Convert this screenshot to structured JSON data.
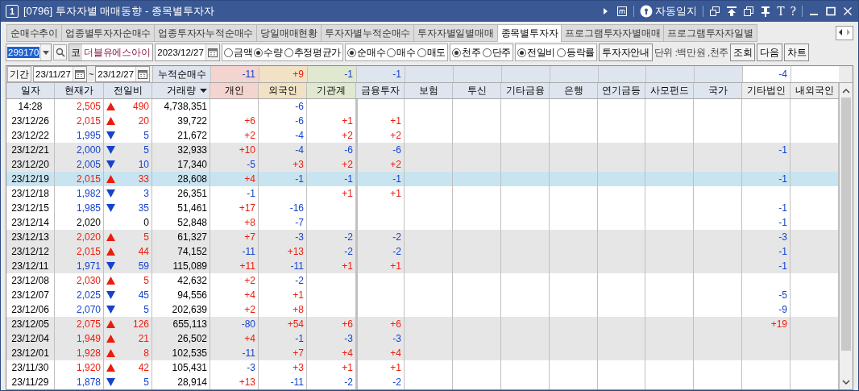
{
  "window": {
    "number": "1",
    "title": "[0796] 투자자별 매매동향 - 종목별투자자",
    "journal": "자동일지",
    "tool_letters": [
      "T",
      "?"
    ]
  },
  "tabs": [
    {
      "label": "순매수추이",
      "selected": false
    },
    {
      "label": "업종별투자자순매수",
      "selected": false
    },
    {
      "label": "업종투자자누적순매수",
      "selected": false
    },
    {
      "label": "당일매매현황",
      "selected": false
    },
    {
      "label": "투자자별누적순매수",
      "selected": false
    },
    {
      "label": "투자자별일별매매",
      "selected": false
    },
    {
      "label": "종목별투자자",
      "selected": true
    },
    {
      "label": "프로그램투자자별매매",
      "selected": false
    },
    {
      "label": "프로그램투자자일별",
      "selected": false
    }
  ],
  "toolbar": {
    "code": {
      "value": "299170",
      "highlighted": true
    },
    "market": "코",
    "stock_name": "더블유에스아이",
    "date": "2023/12/27",
    "radio_groups": [
      [
        {
          "label": "금액",
          "selected": false
        },
        {
          "label": "수량",
          "selected": true
        },
        {
          "label": "추정평균가",
          "selected": false
        }
      ],
      [
        {
          "label": "순매수",
          "selected": true
        },
        {
          "label": "매수",
          "selected": false
        },
        {
          "label": "매도",
          "selected": false
        }
      ],
      [
        {
          "label": "천주",
          "selected": true
        },
        {
          "label": "단주",
          "selected": false
        }
      ],
      [
        {
          "label": "전일비",
          "selected": true
        },
        {
          "label": "등락률",
          "selected": false
        }
      ]
    ],
    "guide_button": "투자자안내",
    "unit": "단위 :백만원 ,천주",
    "buttons": [
      "조회",
      "다음",
      "차트"
    ]
  },
  "period": {
    "label": "기간",
    "from": "23/11/27",
    "separator": "~",
    "to": "23/12/27"
  },
  "summary": {
    "label": "누적순매수",
    "values": {
      "individual": "-11",
      "foreign": "+9",
      "institutions": "-1",
      "financial_investment": "-1",
      "other_corporations": "-4"
    }
  },
  "table": {
    "columns": [
      {
        "label": "일자",
        "dropdown": false
      },
      {
        "label": "현재가",
        "dropdown": false
      },
      {
        "label": "전일비",
        "dropdown": false
      },
      {
        "label": "거래량",
        "dropdown": true
      },
      {
        "label": "개인",
        "dropdown": false
      },
      {
        "label": "외국인",
        "dropdown": false
      },
      {
        "label": "기관계",
        "dropdown": false
      },
      {
        "label": "금융투자",
        "dropdown": false
      },
      {
        "label": "보험",
        "dropdown": false
      },
      {
        "label": "투신",
        "dropdown": false
      },
      {
        "label": "기타금융",
        "dropdown": false
      },
      {
        "label": "은행",
        "dropdown": false
      },
      {
        "label": "연기금등",
        "dropdown": false
      },
      {
        "label": "사모펀드",
        "dropdown": false
      },
      {
        "label": "국가",
        "dropdown": false
      },
      {
        "label": "기타법인",
        "dropdown": false
      },
      {
        "label": "내외국인",
        "dropdown": false
      }
    ],
    "rows": [
      {
        "date": "14:28",
        "price": "2,505",
        "kind": "up",
        "change": "490",
        "volume": "4,738,351",
        "shaded": false,
        "selected": false,
        "investors": {
          "foreign": "-6"
        }
      },
      {
        "date": "23/12/26",
        "price": "2,015",
        "kind": "up",
        "change": "20",
        "volume": "39,722",
        "shaded": false,
        "selected": false,
        "investors": {
          "individual": "+6",
          "foreign": "-6",
          "institutions": "+1",
          "financial_investment": "+1"
        }
      },
      {
        "date": "23/12/22",
        "price": "1,995",
        "kind": "down",
        "change": "5",
        "volume": "21,672",
        "shaded": false,
        "selected": false,
        "investors": {
          "individual": "+2",
          "foreign": "-4",
          "institutions": "+2",
          "financial_investment": "+2"
        }
      },
      {
        "date": "23/12/21",
        "price": "2,000",
        "kind": "down",
        "change": "5",
        "volume": "32,933",
        "shaded": true,
        "selected": false,
        "investors": {
          "individual": "+10",
          "foreign": "-4",
          "institutions": "-6",
          "financial_investment": "-6",
          "other_corporations": "-1"
        }
      },
      {
        "date": "23/12/20",
        "price": "2,005",
        "kind": "down",
        "change": "10",
        "volume": "17,340",
        "shaded": true,
        "selected": false,
        "investors": {
          "individual": "-5",
          "foreign": "+3",
          "institutions": "+2",
          "financial_investment": "+2"
        }
      },
      {
        "date": "23/12/19",
        "price": "2,015",
        "kind": "up",
        "change": "33",
        "volume": "28,608",
        "selected": true,
        "investors": {
          "individual": "+4",
          "foreign": "-1",
          "institutions": "-1",
          "financial_investment": "-1",
          "other_corporations": "-1"
        }
      },
      {
        "date": "23/12/18",
        "price": "1,982",
        "kind": "down",
        "change": "3",
        "volume": "26,351",
        "shaded": false,
        "selected": false,
        "investors": {
          "individual": "-1",
          "institutions": "+1",
          "financial_investment": "+1"
        }
      },
      {
        "date": "23/12/15",
        "price": "1,985",
        "kind": "down",
        "change": "35",
        "volume": "51,461",
        "shaded": false,
        "selected": false,
        "investors": {
          "individual": "+17",
          "foreign": "-16",
          "other_corporations": "-1"
        }
      },
      {
        "date": "23/12/14",
        "price": "2,020",
        "kind": "flat",
        "change": "0",
        "volume": "52,848",
        "shaded": false,
        "selected": false,
        "investors": {
          "individual": "+8",
          "foreign": "-7",
          "other_corporations": "-1"
        }
      },
      {
        "date": "23/12/13",
        "price": "2,020",
        "kind": "up",
        "change": "5",
        "volume": "61,327",
        "shaded": true,
        "selected": false,
        "investors": {
          "individual": "+7",
          "foreign": "-3",
          "institutions": "-2",
          "financial_investment": "-2",
          "other_corporations": "-3"
        }
      },
      {
        "date": "23/12/12",
        "price": "2,015",
        "kind": "up",
        "change": "44",
        "volume": "74,152",
        "shaded": true,
        "selected": false,
        "investors": {
          "individual": "-11",
          "foreign": "+13",
          "institutions": "-2",
          "financial_investment": "-2",
          "other_corporations": "-1"
        }
      },
      {
        "date": "23/12/11",
        "price": "1,971",
        "kind": "down",
        "change": "59",
        "volume": "115,089",
        "shaded": true,
        "selected": false,
        "investors": {
          "individual": "+11",
          "foreign": "-11",
          "institutions": "+1",
          "financial_investment": "+1",
          "other_corporations": "-1"
        }
      },
      {
        "date": "23/12/08",
        "price": "2,030",
        "kind": "up",
        "change": "5",
        "volume": "42,632",
        "shaded": false,
        "selected": false,
        "investors": {
          "individual": "+2",
          "foreign": "-2"
        }
      },
      {
        "date": "23/12/07",
        "price": "2,025",
        "kind": "down",
        "change": "45",
        "volume": "94,556",
        "shaded": false,
        "selected": false,
        "investors": {
          "individual": "+4",
          "foreign": "+1",
          "other_corporations": "-5"
        }
      },
      {
        "date": "23/12/06",
        "price": "2,070",
        "kind": "down",
        "change": "5",
        "volume": "202,639",
        "shaded": false,
        "selected": false,
        "investors": {
          "individual": "+2",
          "foreign": "+8",
          "other_corporations": "-9"
        }
      },
      {
        "date": "23/12/05",
        "price": "2,075",
        "kind": "up",
        "change": "126",
        "volume": "655,113",
        "shaded": true,
        "selected": false,
        "investors": {
          "individual": "-80",
          "foreign": "+54",
          "institutions": "+6",
          "financial_investment": "+6",
          "other_corporations": "+19"
        }
      },
      {
        "date": "23/12/04",
        "price": "1,949",
        "kind": "up",
        "change": "21",
        "volume": "26,502",
        "shaded": true,
        "selected": false,
        "investors": {
          "individual": "+4",
          "foreign": "-1",
          "institutions": "-3",
          "financial_investment": "-3"
        }
      },
      {
        "date": "23/12/01",
        "price": "1,928",
        "kind": "up",
        "change": "8",
        "volume": "102,535",
        "shaded": true,
        "selected": false,
        "investors": {
          "individual": "-11",
          "foreign": "+7",
          "institutions": "+4",
          "financial_investment": "+4"
        }
      },
      {
        "date": "23/11/30",
        "price": "1,920",
        "kind": "up",
        "change": "42",
        "volume": "105,431",
        "shaded": false,
        "selected": false,
        "investors": {
          "individual": "-3",
          "foreign": "+3",
          "institutions": "+1",
          "financial_investment": "+1"
        }
      },
      {
        "date": "23/11/29",
        "price": "1,878",
        "kind": "down",
        "change": "5",
        "volume": "28,914",
        "shaded": false,
        "selected": false,
        "investors": {
          "individual": "+13",
          "foreign": "-11",
          "institutions": "-2",
          "financial_investment": "-2"
        }
      }
    ]
  }
}
